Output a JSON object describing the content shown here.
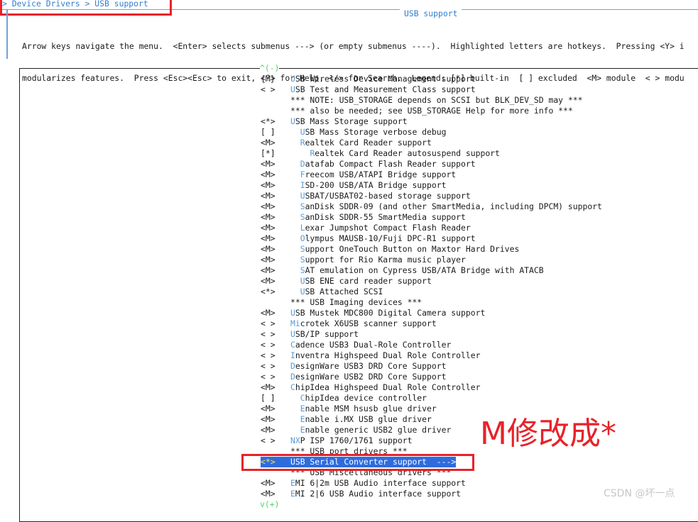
{
  "topbar": {
    "breadcrumb": "> Device Drivers > USB support"
  },
  "window": {
    "title": "USB support",
    "help_line1": "Arrow keys navigate the menu.  <Enter> selects submenus ---> (or empty submenus ----).  Highlighted letters are hotkeys.  Pressing <Y> i",
    "help_line2": "modularizes features.  Press <Esc><Esc> to exit, <?> for Help, </> for Search.  Legend: [*] built-in  [ ] excluded  <M> module  < > modu"
  },
  "scroll": {
    "top": "^(-)",
    "bottom": "v(+)"
  },
  "menu_items": [
    {
      "mark": "{M}",
      "indent": "",
      "hotkey": "U",
      "rest": "SB Wireless Device Management support"
    },
    {
      "mark": "< >",
      "indent": "",
      "hotkey": "U",
      "rest": "SB Test and Measurement Class support"
    },
    {
      "mark": "",
      "indent": "",
      "hotkey": "",
      "rest": "*** NOTE: USB_STORAGE depends on SCSI but BLK_DEV_SD may ***"
    },
    {
      "mark": "",
      "indent": "",
      "hotkey": "",
      "rest": "*** also be needed; see USB_STORAGE Help for more info ***"
    },
    {
      "mark": "<*>",
      "indent": "",
      "hotkey": "U",
      "rest": "SB Mass Storage support"
    },
    {
      "mark": "[ ]",
      "indent": "  ",
      "hotkey": "U",
      "rest": "SB Mass Storage verbose debug"
    },
    {
      "mark": "<M>",
      "indent": "  ",
      "hotkey": "R",
      "rest": "ealtek Card Reader support"
    },
    {
      "mark": "[*]",
      "indent": "    ",
      "hotkey": "R",
      "rest": "ealtek Card Reader autosuspend support"
    },
    {
      "mark": "<M>",
      "indent": "  ",
      "hotkey": "D",
      "rest": "atafab Compact Flash Reader support"
    },
    {
      "mark": "<M>",
      "indent": "  ",
      "hotkey": "F",
      "rest": "reecom USB/ATAPI Bridge support"
    },
    {
      "mark": "<M>",
      "indent": "  ",
      "hotkey": "I",
      "rest": "SD-200 USB/ATA Bridge support"
    },
    {
      "mark": "<M>",
      "indent": "  ",
      "hotkey": "U",
      "rest": "SBAT/USBAT02-based storage support"
    },
    {
      "mark": "<M>",
      "indent": "  ",
      "hotkey": "S",
      "rest": "anDisk SDDR-09 (and other SmartMedia, including DPCM) support"
    },
    {
      "mark": "<M>",
      "indent": "  ",
      "hotkey": "S",
      "rest": "anDisk SDDR-55 SmartMedia support"
    },
    {
      "mark": "<M>",
      "indent": "  ",
      "hotkey": "L",
      "rest": "exar Jumpshot Compact Flash Reader"
    },
    {
      "mark": "<M>",
      "indent": "  ",
      "hotkey": "O",
      "rest": "lympus MAUSB-10/Fuji DPC-R1 support"
    },
    {
      "mark": "<M>",
      "indent": "  ",
      "hotkey": "S",
      "rest": "upport OneTouch Button on Maxtor Hard Drives"
    },
    {
      "mark": "<M>",
      "indent": "  ",
      "hotkey": "S",
      "rest": "upport for Rio Karma music player"
    },
    {
      "mark": "<M>",
      "indent": "  ",
      "hotkey": "S",
      "rest": "AT emulation on Cypress USB/ATA Bridge with ATACB"
    },
    {
      "mark": "<M>",
      "indent": "  ",
      "hotkey": "U",
      "rest": "SB ENE card reader support"
    },
    {
      "mark": "<*>",
      "indent": "  ",
      "hotkey": "U",
      "rest": "SB Attached SCSI"
    },
    {
      "mark": "",
      "indent": "",
      "hotkey": "",
      "rest": "*** USB Imaging devices ***"
    },
    {
      "mark": "<M>",
      "indent": "",
      "hotkey": "U",
      "rest": "SB Mustek MDC800 Digital Camera support"
    },
    {
      "mark": "< >",
      "indent": "",
      "hotkey": "Mi",
      "rest": "crotek X6USB scanner support"
    },
    {
      "mark": "< >",
      "indent": "",
      "hotkey": "U",
      "rest": "SB/IP support"
    },
    {
      "mark": "< >",
      "indent": "",
      "hotkey": "C",
      "rest": "adence USB3 Dual-Role Controller"
    },
    {
      "mark": "< >",
      "indent": "",
      "hotkey": "I",
      "rest": "nventra Highspeed Dual Role Controller"
    },
    {
      "mark": "< >",
      "indent": "",
      "hotkey": "D",
      "rest": "esignWare USB3 DRD Core Support"
    },
    {
      "mark": "< >",
      "indent": "",
      "hotkey": "D",
      "rest": "esignWare USB2 DRD Core Support"
    },
    {
      "mark": "<M>",
      "indent": "",
      "hotkey": "C",
      "rest": "hipIdea Highspeed Dual Role Controller"
    },
    {
      "mark": "[ ]",
      "indent": "  ",
      "hotkey": "C",
      "rest": "hipIdea device controller"
    },
    {
      "mark": "<M>",
      "indent": "  ",
      "hotkey": "E",
      "rest": "nable MSM hsusb glue driver"
    },
    {
      "mark": "<M>",
      "indent": "  ",
      "hotkey": "E",
      "rest": "nable i.MX USB glue driver"
    },
    {
      "mark": "<M>",
      "indent": "  ",
      "hotkey": "E",
      "rest": "nable generic USB2 glue driver"
    },
    {
      "mark": "< >",
      "indent": "",
      "hotkey": "NX",
      "rest": "P ISP 1760/1761 support"
    },
    {
      "mark": "",
      "indent": "",
      "hotkey": "",
      "rest": "*** USB port drivers ***"
    },
    {
      "mark": "<*>",
      "indent": "",
      "hotkey": "U",
      "rest": "SB Serial Converter support  --->",
      "selected": true
    },
    {
      "mark": "",
      "indent": "",
      "hotkey": "",
      "rest": "*** USB Miscellaneous drivers ***"
    },
    {
      "mark": "<M>",
      "indent": "",
      "hotkey": "E",
      "rest": "MI 6|2m USB Audio interface support"
    },
    {
      "mark": "<M>",
      "indent": "",
      "hotkey": "E",
      "rest": "MI 2|6 USB Audio interface support"
    }
  ],
  "annotation": {
    "text": "M修改成*"
  },
  "watermark": {
    "text": "CSDN @坏一点"
  },
  "colors": {
    "accent": "#2f7fcf",
    "highlight_box": "#e8222a",
    "selection": "#2d6cdf",
    "hotkey": "#5b9bd5"
  }
}
